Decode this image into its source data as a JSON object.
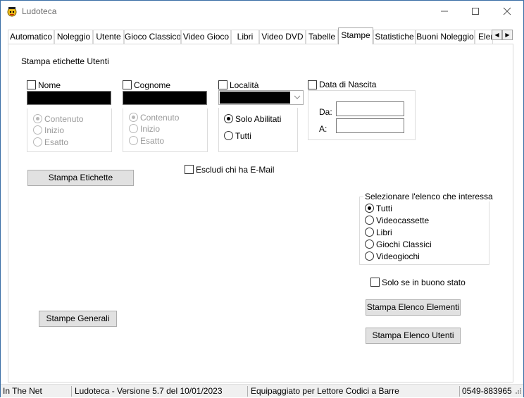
{
  "window": {
    "title": "Ludoteca",
    "icon": "ludoteca-app-icon"
  },
  "tabs": [
    {
      "label": "Automatico",
      "active": false
    },
    {
      "label": "Noleggio",
      "active": false
    },
    {
      "label": "Utente",
      "active": false
    },
    {
      "label": "Gioco Classico",
      "active": false
    },
    {
      "label": "Video Gioco",
      "active": false
    },
    {
      "label": "Libri",
      "active": false
    },
    {
      "label": "Video DVD",
      "active": false
    },
    {
      "label": "Tabelle",
      "active": false
    },
    {
      "label": "Stampe",
      "active": true
    },
    {
      "label": "Statistiche",
      "active": false
    },
    {
      "label": "Buoni Noleggio",
      "active": false
    },
    {
      "label": "Eler",
      "active": false
    }
  ],
  "stampe": {
    "section_title": "Stampa etichette Utenti",
    "nome": {
      "label": "Nome",
      "checked": false
    },
    "cognome": {
      "label": "Cognome",
      "checked": false
    },
    "localita": {
      "label": "Località",
      "checked": false
    },
    "data_nascita": {
      "label": "Data di Nascita",
      "checked": false,
      "da_label": "Da:",
      "a_label": "A:",
      "da_value": "",
      "a_value": ""
    },
    "nome_match": {
      "options": [
        "Contenuto",
        "Inizio",
        "Esatto"
      ],
      "selected": "Contenuto"
    },
    "cognome_match": {
      "options": [
        "Contenuto",
        "Inizio",
        "Esatto"
      ],
      "selected": "Contenuto"
    },
    "abilitati": {
      "options": [
        "Solo Abilitati",
        "Tutti"
      ],
      "selected": "Solo Abilitati"
    },
    "escludi_email": {
      "label": "Escludi chi ha E-Mail",
      "checked": false
    },
    "stampa_etichette_button": "Stampa Etichette",
    "elenco_group": {
      "title": "Selezionare l'elenco che interessa",
      "options": [
        "Tutti",
        "Videocassette",
        "Libri",
        "Giochi Classici",
        "Videogiochi"
      ],
      "selected": "Tutti"
    },
    "buono_stato": {
      "label": "Solo se in buono stato",
      "checked": false
    },
    "stampe_generali_button": "Stampe Generali",
    "stampa_elenco_elementi_button": "Stampa Elenco Elementi",
    "stampa_elenco_utenti_button": "Stampa Elenco Utenti"
  },
  "statusbar": {
    "net": "In The Net",
    "version": "Ludoteca - Versione 5.7 del 10/01/2023",
    "device": "Equipaggiato per Lettore Codici a Barre",
    "phone": "0549-883965"
  }
}
